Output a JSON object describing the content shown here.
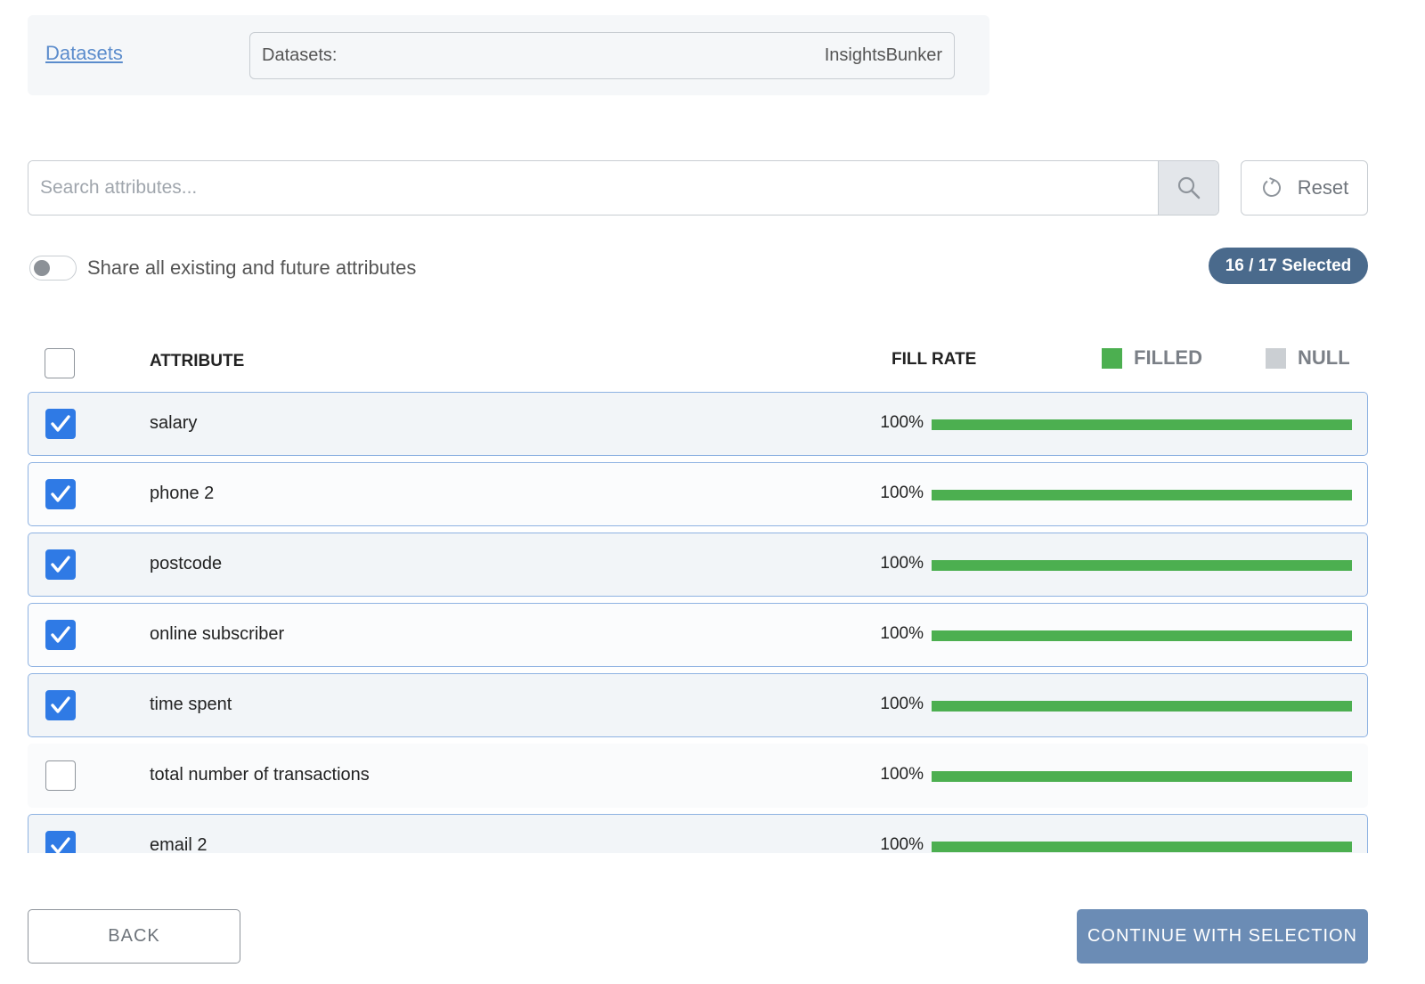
{
  "breadcrumb": {
    "link_label": "Datasets"
  },
  "dataset_field": {
    "label": "Datasets:",
    "value": "InsightsBunker"
  },
  "search": {
    "placeholder": "Search attributes..."
  },
  "reset": {
    "label": "Reset"
  },
  "share_toggle": {
    "label": "Share all existing and future attributes",
    "enabled": false
  },
  "selection_badge": {
    "text": "16 / 17 Selected"
  },
  "table": {
    "header": {
      "attribute": "ATTRIBUTE",
      "fill_rate": "FILL RATE",
      "legend_filled": "FILLED",
      "legend_null": "NULL"
    },
    "rows": [
      {
        "label": "salary",
        "fill_text": "100%",
        "fill": 1.0,
        "checked": true
      },
      {
        "label": "phone 2",
        "fill_text": "100%",
        "fill": 1.0,
        "checked": true
      },
      {
        "label": "postcode",
        "fill_text": "100%",
        "fill": 1.0,
        "checked": true
      },
      {
        "label": "online subscriber",
        "fill_text": "100%",
        "fill": 1.0,
        "checked": true
      },
      {
        "label": "time spent",
        "fill_text": "100%",
        "fill": 1.0,
        "checked": true
      },
      {
        "label": "total number of transactions",
        "fill_text": "100%",
        "fill": 1.0,
        "checked": false
      },
      {
        "label": "email 2",
        "fill_text": "100%",
        "fill": 1.0,
        "checked": true
      }
    ]
  },
  "footer": {
    "back_label": "BACK",
    "continue_label": "CONTINUE WITH SELECTION"
  },
  "colors": {
    "filled": "#4caf50",
    "null": "#cbcfd3",
    "accent": "#2f7ae5",
    "badge": "#4a6a8c",
    "continue": "#6b8cb5",
    "link": "#5b8ccc"
  },
  "icons": {
    "search": "search-icon",
    "reset": "refresh-icon",
    "check": "checkmark-icon"
  }
}
